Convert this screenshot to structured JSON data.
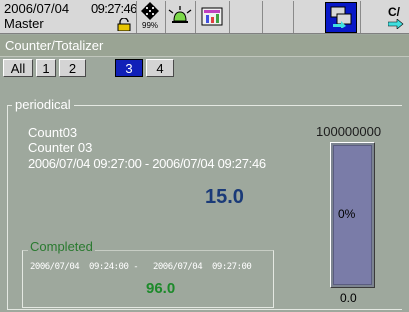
{
  "status": {
    "date": "2006/07/04",
    "time": "09:27:46",
    "user": "Master",
    "memory_percent": "99%",
    "partial_label": "C/"
  },
  "icons": {
    "lock": "lock-icon",
    "memory": "memory-icon",
    "alarm": "alarm-icon",
    "display": "display-icon",
    "active": "display-switch-icon",
    "next": "c-icon"
  },
  "colors": {
    "accent_blue": "#1020b8",
    "value_blue": "#1a3a78",
    "completed_green": "#1c8a2a",
    "panel_bg": "#9ea89d"
  },
  "title": "Counter/Totalizer",
  "tabs": [
    {
      "label": "All",
      "active": false
    },
    {
      "label": "1",
      "active": false
    },
    {
      "label": "2",
      "active": false
    },
    {
      "label": "3",
      "active": true
    },
    {
      "label": "4",
      "active": false
    }
  ],
  "periodical": {
    "label": "periodical",
    "count_name": "Count03",
    "counter_desc": "Counter 03",
    "range": "2006/07/04  09:27:00 - 2006/07/04  09:27:46",
    "value": "15.0",
    "bar_max": "100000000",
    "bar_percent": "0%",
    "bar_fraction": 0.0,
    "bar_min": "0.0"
  },
  "completed": {
    "label": "Completed",
    "range": "2006/07/04  09:24:00 -   2006/07/04  09:27:00",
    "value": "96.0"
  }
}
